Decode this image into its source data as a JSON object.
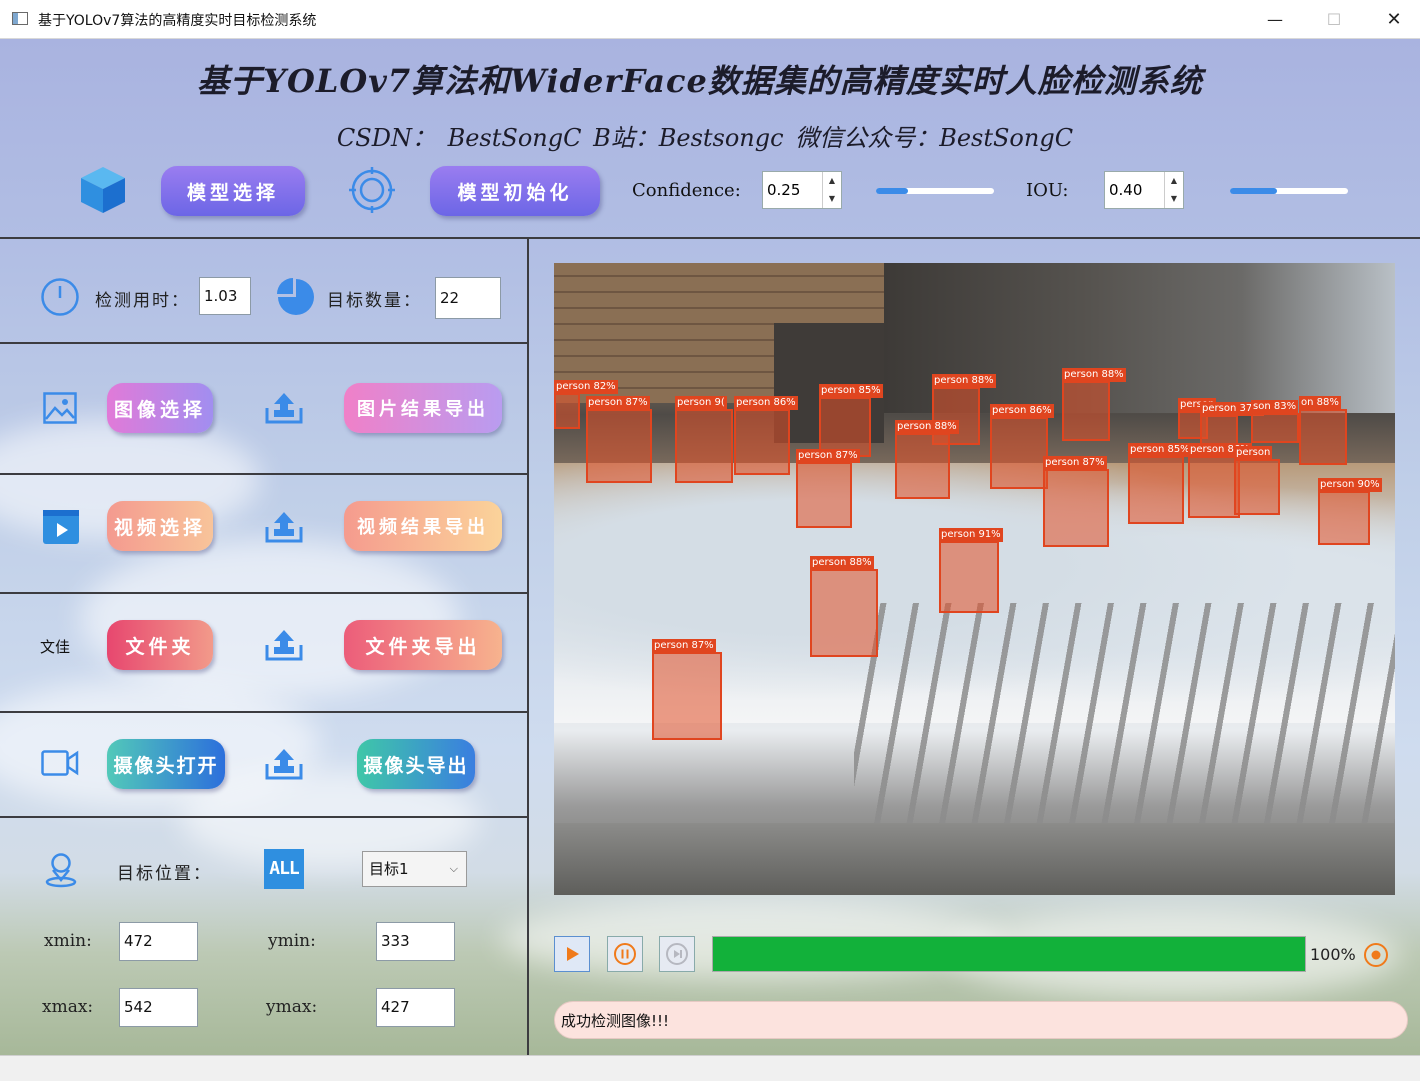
{
  "window": {
    "title": "基于YOLOv7算法的高精度实时目标检测系统",
    "controls": {
      "minimize": "—",
      "maximize": "☐",
      "close": "✕"
    }
  },
  "header": {
    "main_title": "基于YOLOv7算法和WiderFace数据集的高精度实时人脸检测系统",
    "subtitle": "CSDN： BestSongC   B站：Bestsongc   微信公众号：BestSongC"
  },
  "toolbar": {
    "model_select_label": "模型选择",
    "model_init_label": "模型初始化",
    "confidence_label": "Confidence:",
    "confidence_value": "0.25",
    "confidence_slider_level": 0.27,
    "iou_label": "IOU:",
    "iou_value": "0.40",
    "iou_slider_level": 0.4
  },
  "stats": {
    "time_label": "检测用时：",
    "time_value": "1.03",
    "count_label": "目标数量：",
    "count_value": "22"
  },
  "actions": {
    "image_select": "图像选择",
    "image_export": "图片结果导出",
    "video_select": "视频选择",
    "video_export": "视频结果导出",
    "file_tag": "文佳",
    "folder": "文件夹",
    "folder_export": "文件夹导出",
    "camera_open": "摄像头打开",
    "camera_export": "摄像头导出"
  },
  "position": {
    "label": "目标位置：",
    "all_badge": "ALL",
    "target_select": "目标1",
    "xmin_label": "xmin:",
    "xmin": "472",
    "ymin_label": "ymin:",
    "ymin": "333",
    "xmax_label": "xmax:",
    "xmax": "542",
    "ymax_label": "ymax:",
    "ymax": "427"
  },
  "detections": [
    {
      "label": "person 82%"
    },
    {
      "label": "person 87%"
    },
    {
      "label": "person 9("
    },
    {
      "label": "person 86%"
    },
    {
      "label": "person 85%"
    },
    {
      "label": "person 88%"
    },
    {
      "label": "person 88%"
    },
    {
      "label": "person 88%"
    },
    {
      "label": "person 86%"
    },
    {
      "label": "person 87%"
    },
    {
      "label": "person 87%"
    },
    {
      "label": "person 85%"
    },
    {
      "label": "person"
    },
    {
      "label": "person 37%"
    },
    {
      "label": "son 83%"
    },
    {
      "label": "on 88%"
    },
    {
      "label": "person 86%"
    },
    {
      "label": "person 90%"
    },
    {
      "label": "person 91%"
    },
    {
      "label": "person 88%"
    },
    {
      "label": "person 87%"
    },
    {
      "label": "person"
    }
  ],
  "playback": {
    "progress_text": "100%",
    "progress_value": 1.0
  },
  "status_message": "成功检测图像!!!",
  "colors": {
    "accent_blue": "#3b8be8",
    "progress_green": "#12b13a",
    "box_red": "#e0451f"
  }
}
